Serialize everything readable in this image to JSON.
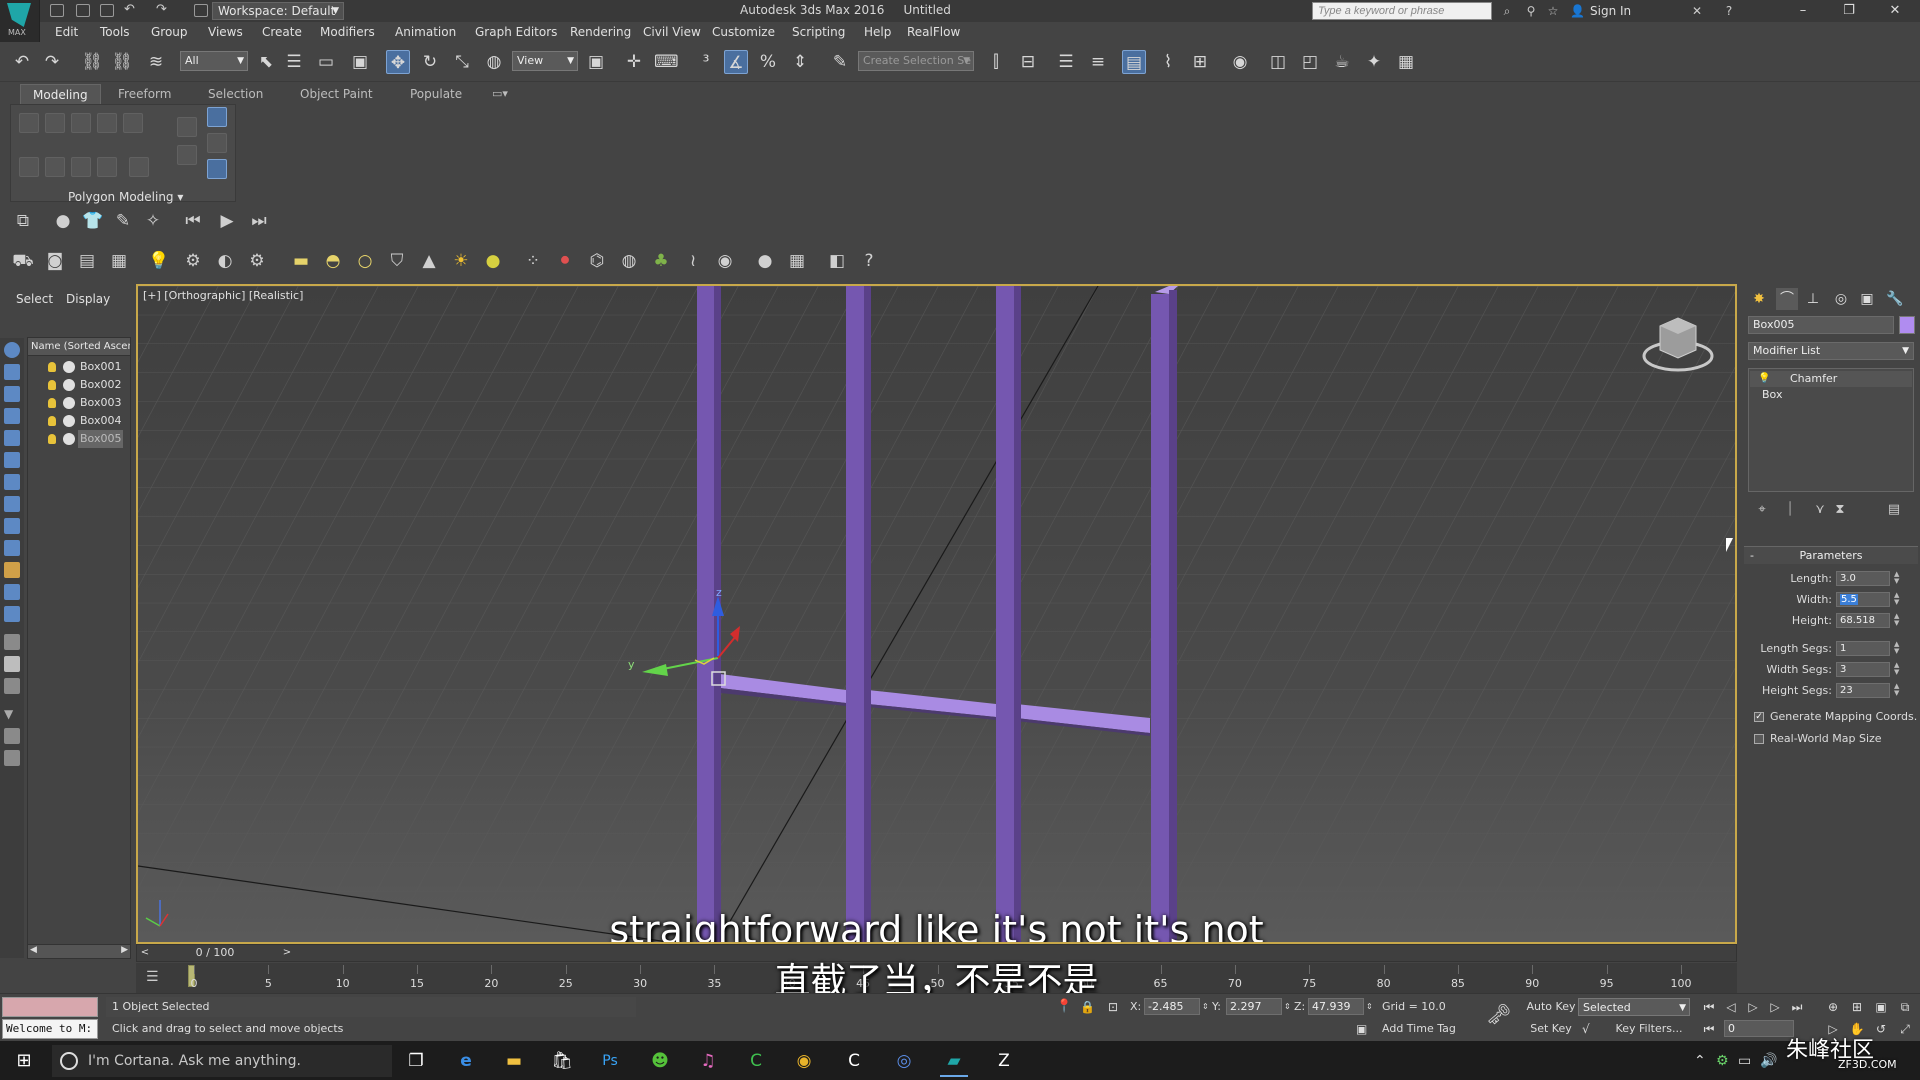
{
  "titlebar": {
    "logo_text": "MAX",
    "workspace": "Workspace: Default",
    "app_title": "Autodesk 3ds Max 2016",
    "doc_title": "Untitled",
    "search_placeholder": "Type a keyword or phrase",
    "sign_in": "Sign In"
  },
  "menu": [
    "Edit",
    "Tools",
    "Group",
    "Views",
    "Create",
    "Modifiers",
    "Animation",
    "Graph Editors",
    "Rendering",
    "Civil View",
    "Customize",
    "Scripting",
    "Help",
    "RealFlow"
  ],
  "main_toolbar": {
    "selection_filter": "All",
    "ref_coord": "View",
    "named_selection": "Create Selection Se",
    "active_tool": "select-and-move"
  },
  "ribbon": {
    "tabs": [
      "Modeling",
      "Freeform",
      "Selection",
      "Object Paint",
      "Populate"
    ],
    "active_tab": "Modeling",
    "panel_label": "Polygon Modeling"
  },
  "explorer": {
    "tabs": [
      "Select",
      "Display"
    ],
    "header": "Name (Sorted Ascen",
    "items": [
      "Box001",
      "Box002",
      "Box003",
      "Box004",
      "Box005"
    ],
    "selected": "Box005"
  },
  "viewport": {
    "label": "[+] [Orthographic] [Realistic]",
    "object_color": "#9a74d6",
    "axis_labels": {
      "x": "x",
      "y": "y",
      "z": "z"
    }
  },
  "subtitles": {
    "english": "straightforward like it's not it's not",
    "chinese": "直截了当，不是不是"
  },
  "command_panel": {
    "object_name": "Box005",
    "modifier_list": "Modifier List",
    "stack": [
      "Chamfer",
      "Box"
    ],
    "rollout_title": "Parameters",
    "params": [
      {
        "label": "Length:",
        "value": "3.0"
      },
      {
        "label": "Width:",
        "value": "5.5"
      },
      {
        "label": "Height:",
        "value": "68.518"
      },
      {
        "label": "Length Segs:",
        "value": "1"
      },
      {
        "label": "Width Segs:",
        "value": "3"
      },
      {
        "label": "Height Segs:",
        "value": "23"
      }
    ],
    "checkboxes": [
      {
        "label": "Generate Mapping Coords.",
        "checked": true
      },
      {
        "label": "Real-World Map Size",
        "checked": false
      }
    ]
  },
  "time": {
    "frame": "0 / 100",
    "ticks": [
      "0",
      "5",
      "10",
      "15",
      "20",
      "25",
      "30",
      "35",
      "40",
      "45",
      "50",
      "55",
      "60",
      "65",
      "70",
      "75",
      "80",
      "85",
      "90",
      "95",
      "100"
    ]
  },
  "status": {
    "maxscript": "Welcome to M:",
    "selection": "1 Object Selected",
    "prompt": "Click and drag to select and move objects",
    "x_label": "X:",
    "x": "-2.485",
    "y_label": "Y:",
    "y": "2.297",
    "z_label": "Z:",
    "z": "47.939",
    "grid": "Grid = 10.0",
    "add_time_tag": "Add Time Tag",
    "auto_key": "Auto Key",
    "set_key": "Set Key",
    "key_mode": "Selected",
    "key_filters": "Key Filters...",
    "current_frame": "0"
  },
  "taskbar": {
    "cortana": "I'm Cortana. Ask me anything."
  },
  "watermark": {
    "brand": "朱峰社区",
    "url": "ZF3D.COM"
  }
}
